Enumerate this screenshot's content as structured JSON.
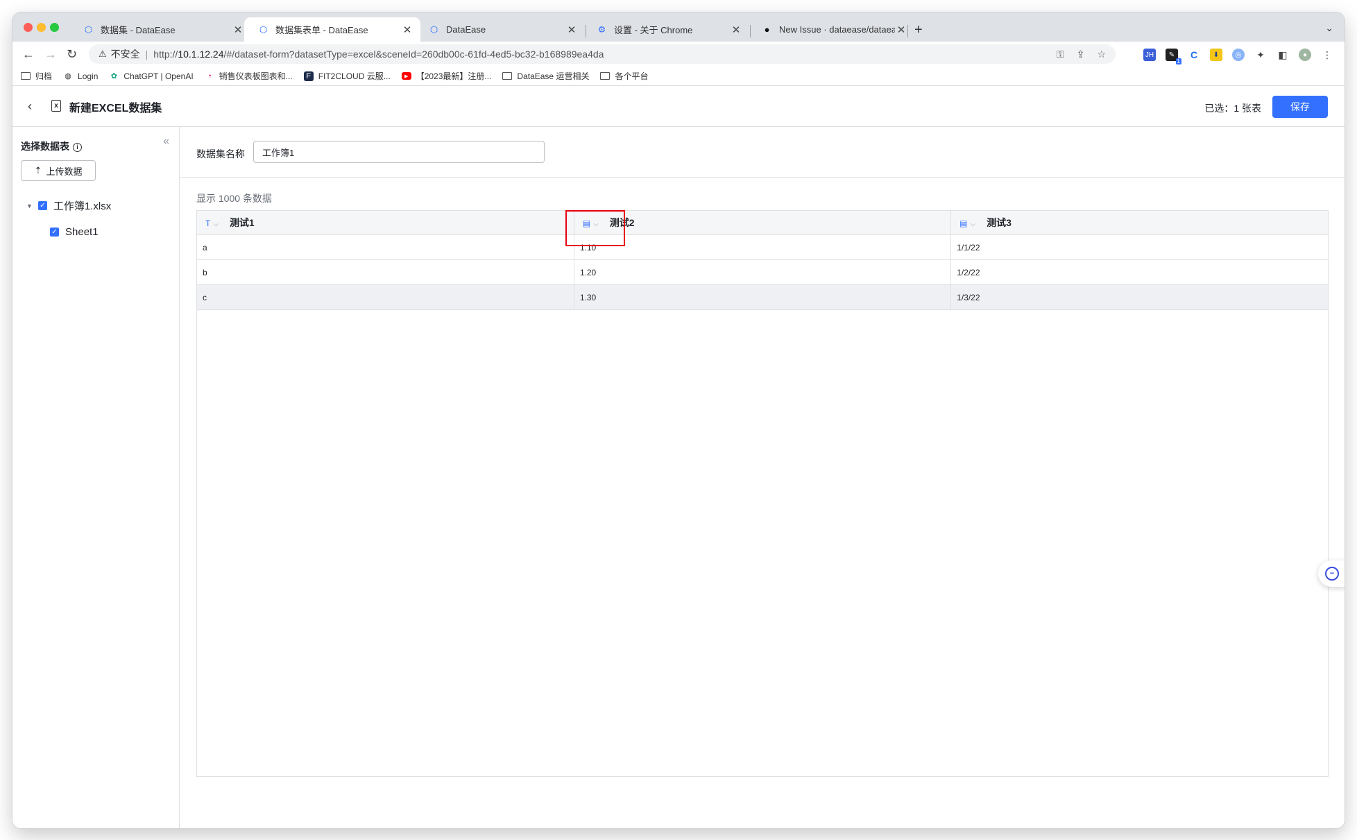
{
  "browser": {
    "tabs": [
      {
        "title": "数据集 - DataEase",
        "active": false
      },
      {
        "title": "数据集表单 - DataEase",
        "active": true
      },
      {
        "title": "DataEase",
        "active": false
      },
      {
        "title": "设置 - 关于 Chrome",
        "active": false
      },
      {
        "title": "New Issue · dataease/dataease",
        "active": false
      }
    ],
    "new_tab": "+",
    "omnibox": {
      "security_label": "不安全",
      "url_prefix": "http://",
      "url_host": "10.1.12.24",
      "url_rest": "/#/dataset-form?datasetType=excel&sceneId=260db00c-61fd-4ed5-bc32-b168989ea4da"
    },
    "bookmarks": [
      {
        "label": "归档",
        "icon": "folder-icon"
      },
      {
        "label": "Login",
        "icon": "globe-icon"
      },
      {
        "label": "ChatGPT | OpenAI",
        "icon": "openai-icon"
      },
      {
        "label": "销售仪表板图表和...",
        "icon": "chart-icon"
      },
      {
        "label": "FIT2CLOUD 云服...",
        "icon": "fit2cloud-icon"
      },
      {
        "label": "【2023最新】注册...",
        "icon": "youtube-icon"
      },
      {
        "label": "DataEase 运营相关",
        "icon": "folder-icon"
      },
      {
        "label": "各个平台",
        "icon": "folder-icon"
      }
    ],
    "extensions": {
      "jh_label": "JH",
      "badge": "1"
    }
  },
  "header": {
    "title": "新建EXCEL数据集",
    "selected_label": "已选：",
    "selected_count": "1 张表",
    "save_label": "保存"
  },
  "sidebar": {
    "title": "选择数据表",
    "upload_label": "上传数据",
    "tree": {
      "file": "工作簿1.xlsx",
      "sheets": [
        "Sheet1"
      ]
    }
  },
  "form": {
    "name_label": "数据集名称",
    "name_value": "工作簿1"
  },
  "preview": {
    "count_note": "显示 1000 条数据",
    "columns": [
      {
        "name": "测试1",
        "type_icon": "T"
      },
      {
        "name": "测试2",
        "type_icon": "▤"
      },
      {
        "name": "测试3",
        "type_icon": "▤"
      }
    ],
    "rows": [
      [
        "a",
        "1.10",
        "1/1/22"
      ],
      [
        "b",
        "1.20",
        "1/2/22"
      ],
      [
        "c",
        "1.30",
        "1/3/22"
      ]
    ]
  },
  "colors": {
    "accent": "#3370ff",
    "highlight": "#e60012"
  }
}
